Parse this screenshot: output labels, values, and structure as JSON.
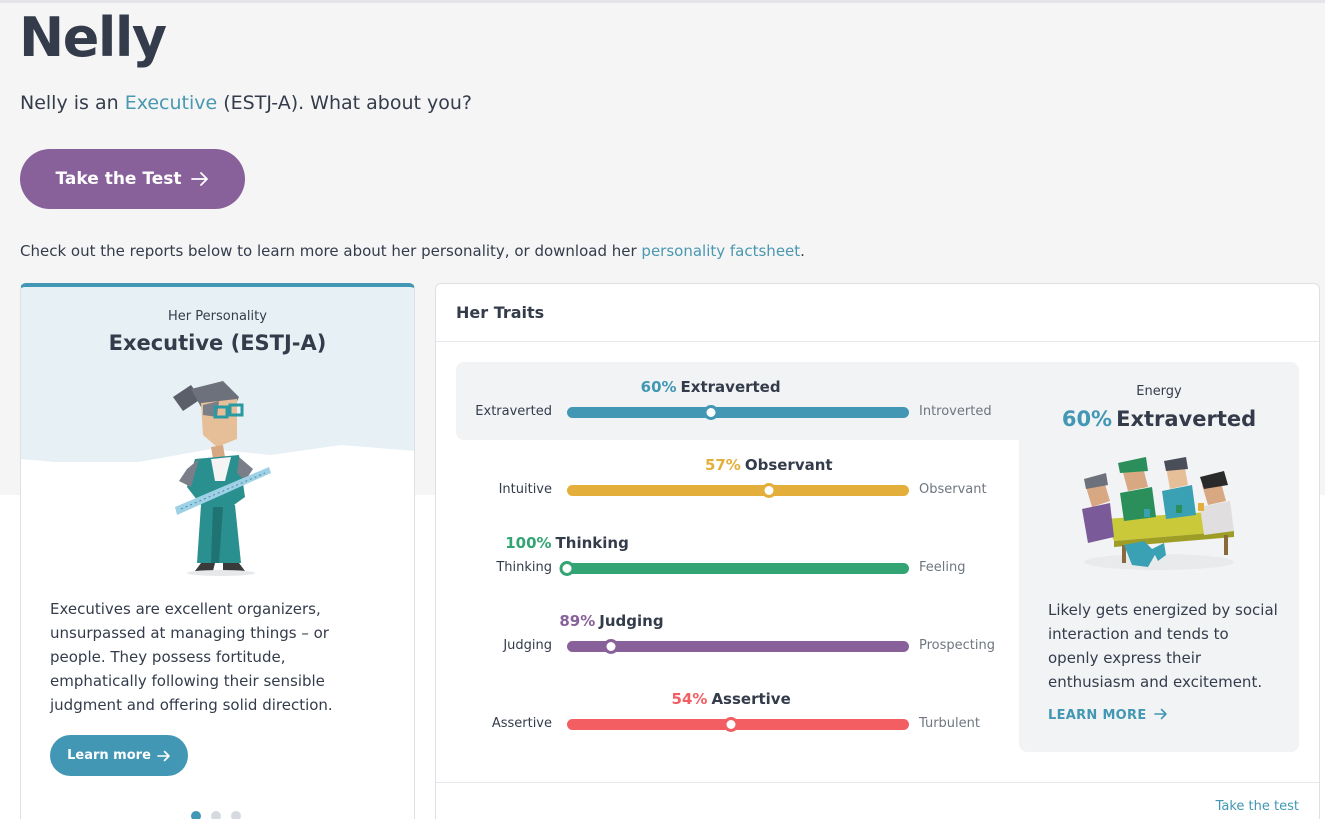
{
  "header": {
    "name": "Nelly",
    "intro_prefix": "Nelly is an ",
    "intro_type_link": "Executive",
    "intro_suffix": " (ESTJ-A). What about you?",
    "take_test_label": "Take the Test",
    "check_prefix": "Check out the reports below to learn more about her personality, or download her ",
    "check_link": "personality factsheet",
    "check_suffix": "."
  },
  "personality_card": {
    "subtitle": "Her Personality",
    "title": "Executive (ESTJ-A)",
    "description": "Executives are excellent organizers, unsurpassed at managing things – or people. They possess fortitude, emphatically following their sensible judgment and offering solid direction.",
    "learn_more_label": "Learn more",
    "carousel_pages": 3,
    "carousel_active": 1,
    "accent_color": "#4298b4"
  },
  "traits_card": {
    "title": "Her Traits",
    "traits": [
      {
        "percent": "60%",
        "label": "Extraverted",
        "left": "Extraverted",
        "right": "Introverted",
        "color": "#4298b4",
        "knob_position": 0.42
      },
      {
        "percent": "57%",
        "label": "Observant",
        "left": "Intuitive",
        "right": "Observant",
        "color": "#e4ae3a",
        "knob_position": 0.59
      },
      {
        "percent": "100%",
        "label": "Thinking",
        "left": "Thinking",
        "right": "Feeling",
        "color": "#33a474",
        "knob_position": 0.0
      },
      {
        "percent": "89%",
        "label": "Judging",
        "left": "Judging",
        "right": "Prospecting",
        "color": "#88619a",
        "knob_position": 0.13
      },
      {
        "percent": "54%",
        "label": "Assertive",
        "left": "Assertive",
        "right": "Turbulent",
        "color": "#f25e62",
        "knob_position": 0.48
      }
    ],
    "energy": {
      "label": "Energy",
      "percent": "60%",
      "trait": "Extraverted",
      "description": "Likely gets energized by social interaction and tends to openly express their enthusiasm and excitement.",
      "learn_more_label": "LEARN MORE"
    },
    "take_test_link": "Take the test"
  }
}
